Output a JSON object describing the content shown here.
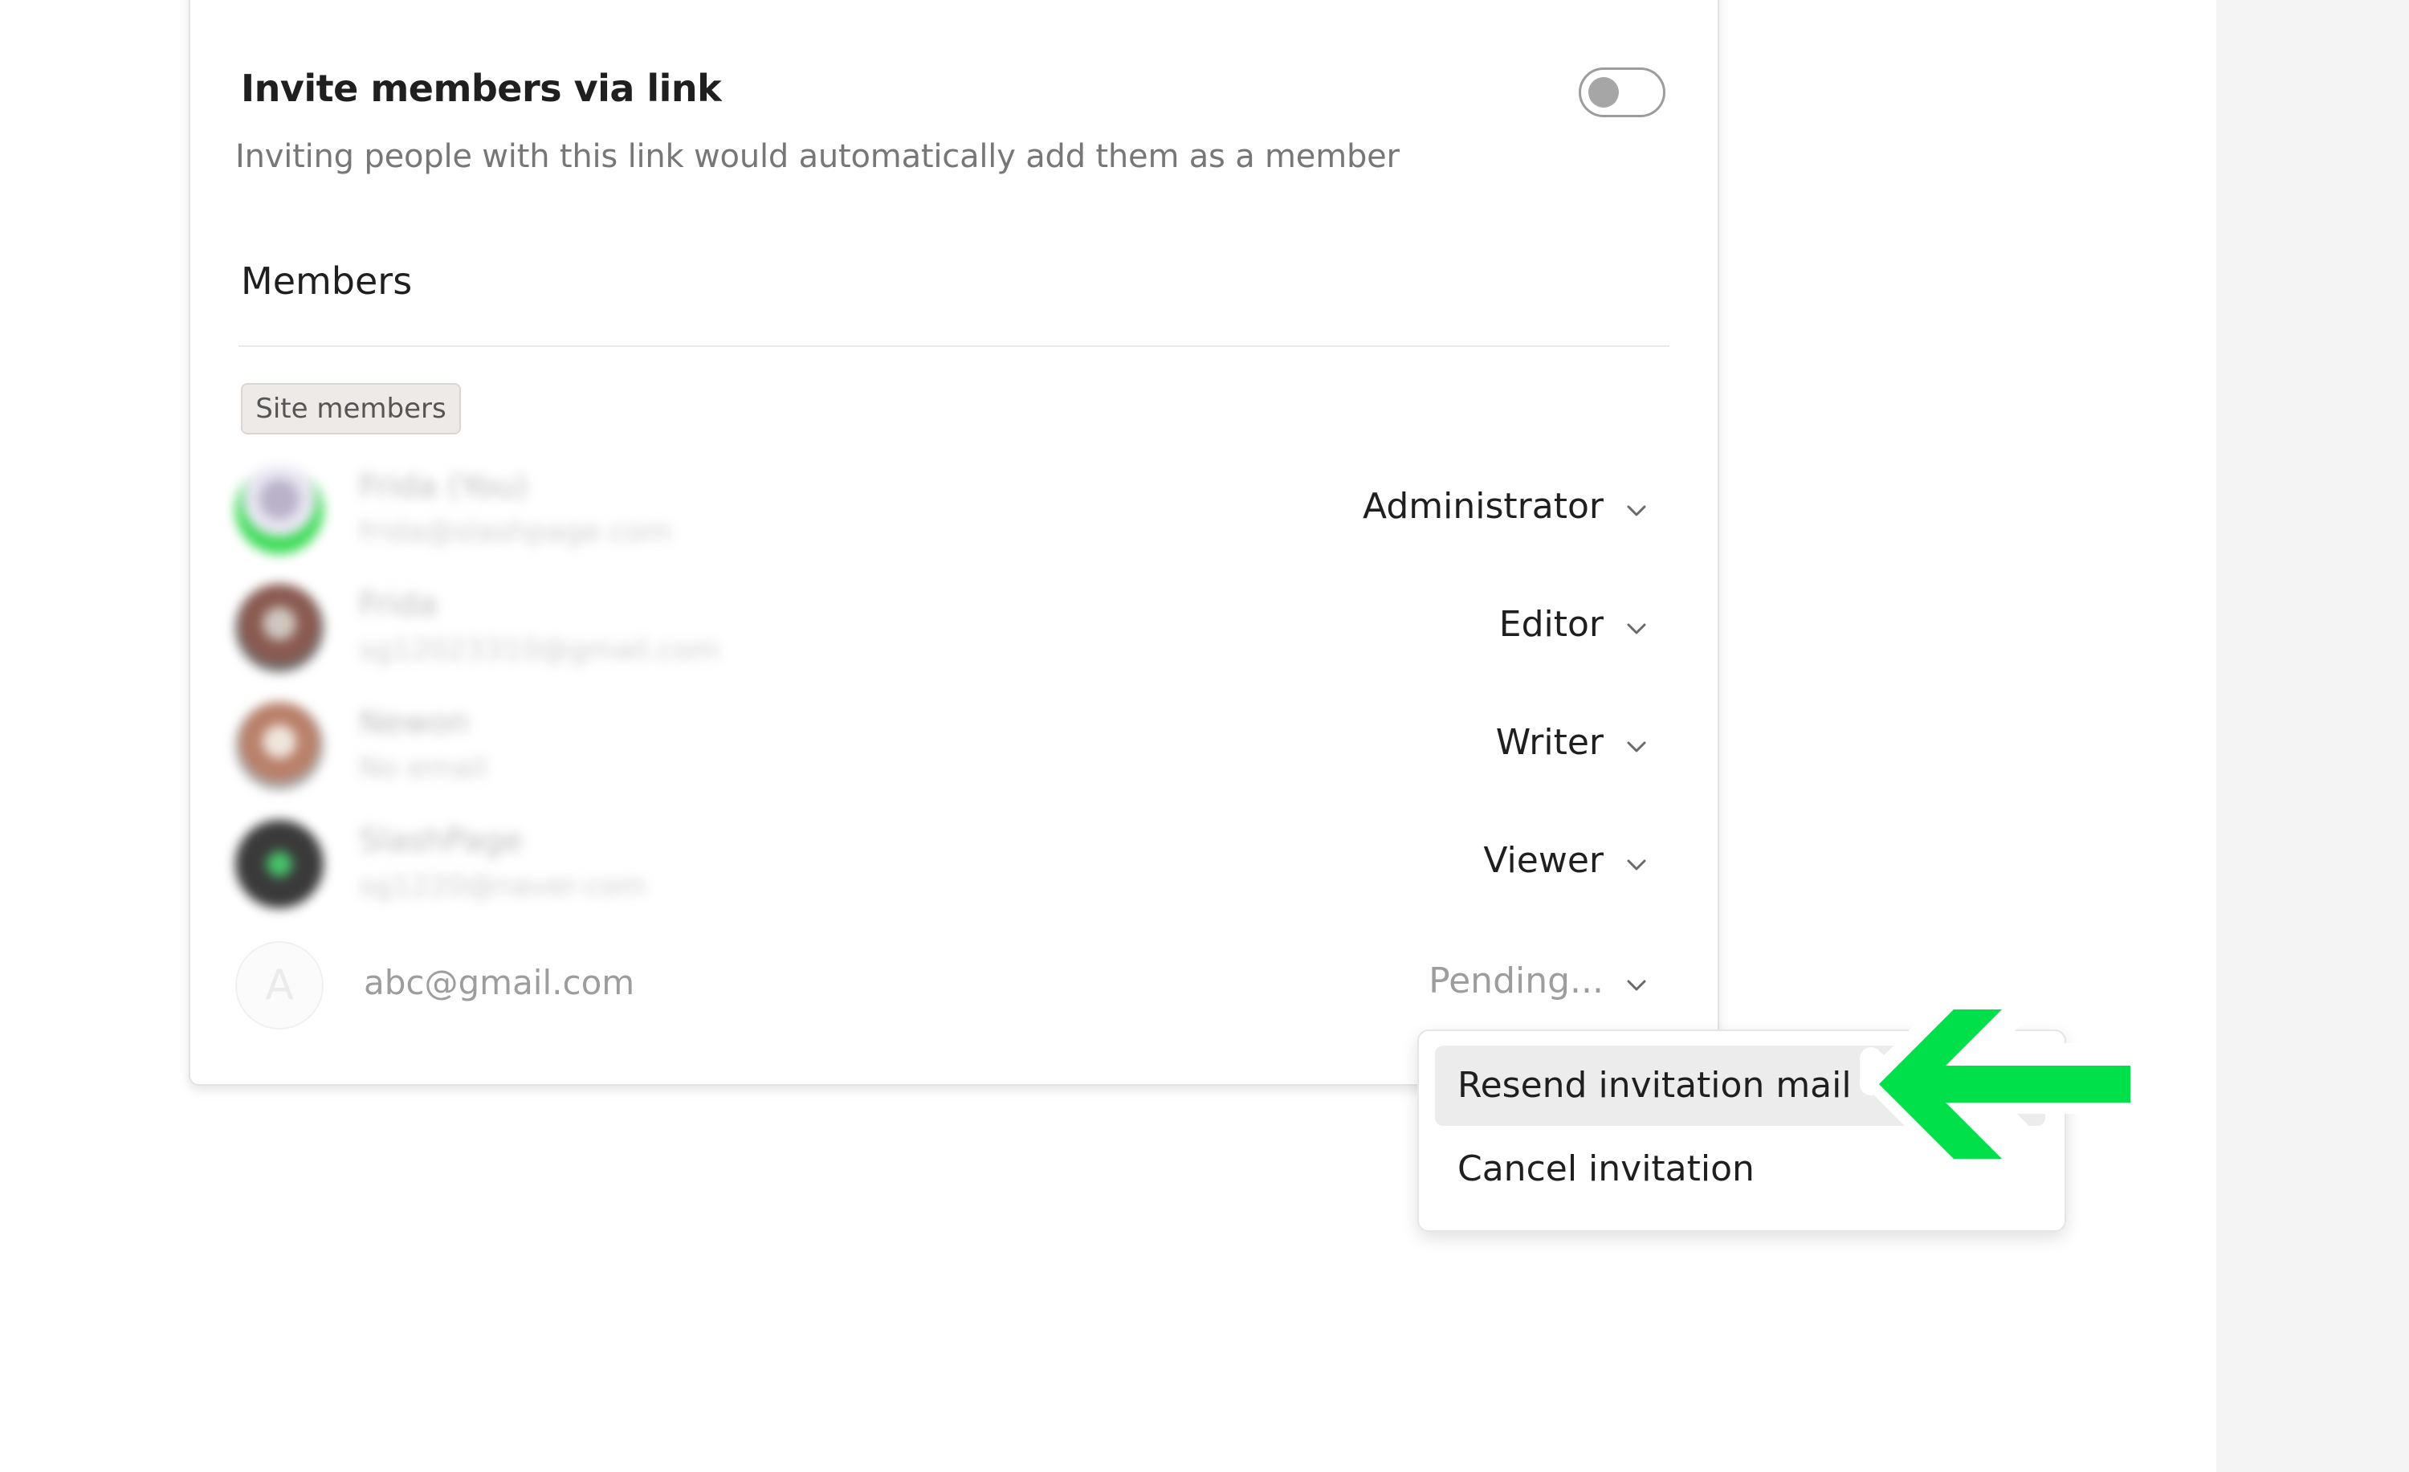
{
  "invite_link": {
    "title": "Invite members via link",
    "description": "Inviting people with this link would automatically add them as a member",
    "toggle_on": false
  },
  "members": {
    "title": "Members",
    "group_label": "Site members",
    "rows": [
      {
        "name": "Frida (You)",
        "email": "frida@slashpage.com",
        "role": "Administrator"
      },
      {
        "name": "Frida",
        "email": "sg12023310@gmail.com",
        "role": "Editor"
      },
      {
        "name": "Newon",
        "email": "No email",
        "role": "Writer"
      },
      {
        "name": "SlashPage",
        "email": "sg1220@naver.com",
        "role": "Viewer"
      }
    ],
    "pending": {
      "avatar_letter": "A",
      "email": "abc@gmail.com",
      "status": "Pending..."
    }
  },
  "dropdown": {
    "items": [
      {
        "label": "Resend invitation mail",
        "highlighted": true
      },
      {
        "label": "Cancel invitation",
        "highlighted": false
      }
    ]
  },
  "colors": {
    "annotation_arrow": "#00e04b",
    "toggle_knob": "#a6a6a6",
    "side_panel": "#f4f4f4"
  }
}
